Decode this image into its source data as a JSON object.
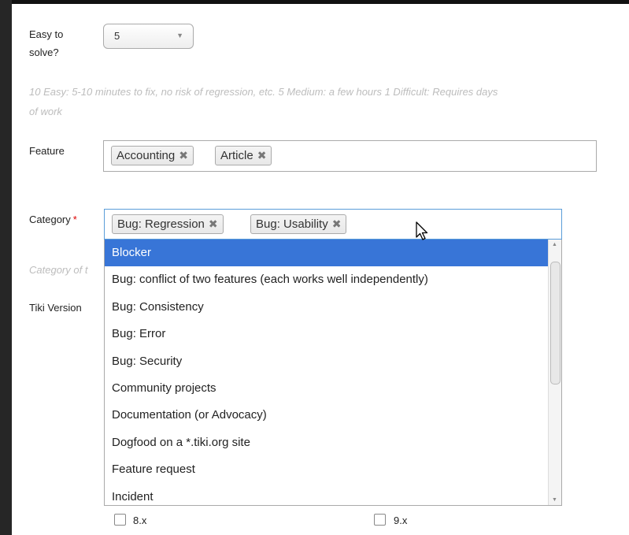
{
  "easy": {
    "label_line1": "Easy to",
    "label_line2": "solve?",
    "value": "5",
    "help_line1": "10 Easy: 5-10 minutes to fix, no risk of regression, etc. 5 Medium: a few hours 1 Difficult: Requires days",
    "help_line2": "of work"
  },
  "feature": {
    "label": "Feature",
    "tags": [
      "Accounting",
      "Article"
    ]
  },
  "category": {
    "label": "Category",
    "required_mark": "*",
    "tags": [
      "Bug: Regression",
      "Bug: Usability"
    ],
    "help_partial": "Category of t"
  },
  "tiki_version": {
    "label": "Tiki Version",
    "options": [
      "8.x",
      "9.x"
    ]
  },
  "dropdown": {
    "options": [
      "Blocker",
      "Bug: conflict of two features (each works well independently)",
      "Bug: Consistency",
      "Bug: Error",
      "Bug: Security",
      "Community projects",
      "Documentation (or Advocacy)",
      "Dogfood on a *.tiki.org site",
      "Feature request",
      "Incident"
    ],
    "highlighted": "Blocker"
  },
  "icons": {
    "remove": "✖",
    "select_arrow": "▼"
  },
  "colors": {
    "highlight": "#3875d7",
    "required": "#dd0000",
    "help_text": "#bdbdbd"
  }
}
